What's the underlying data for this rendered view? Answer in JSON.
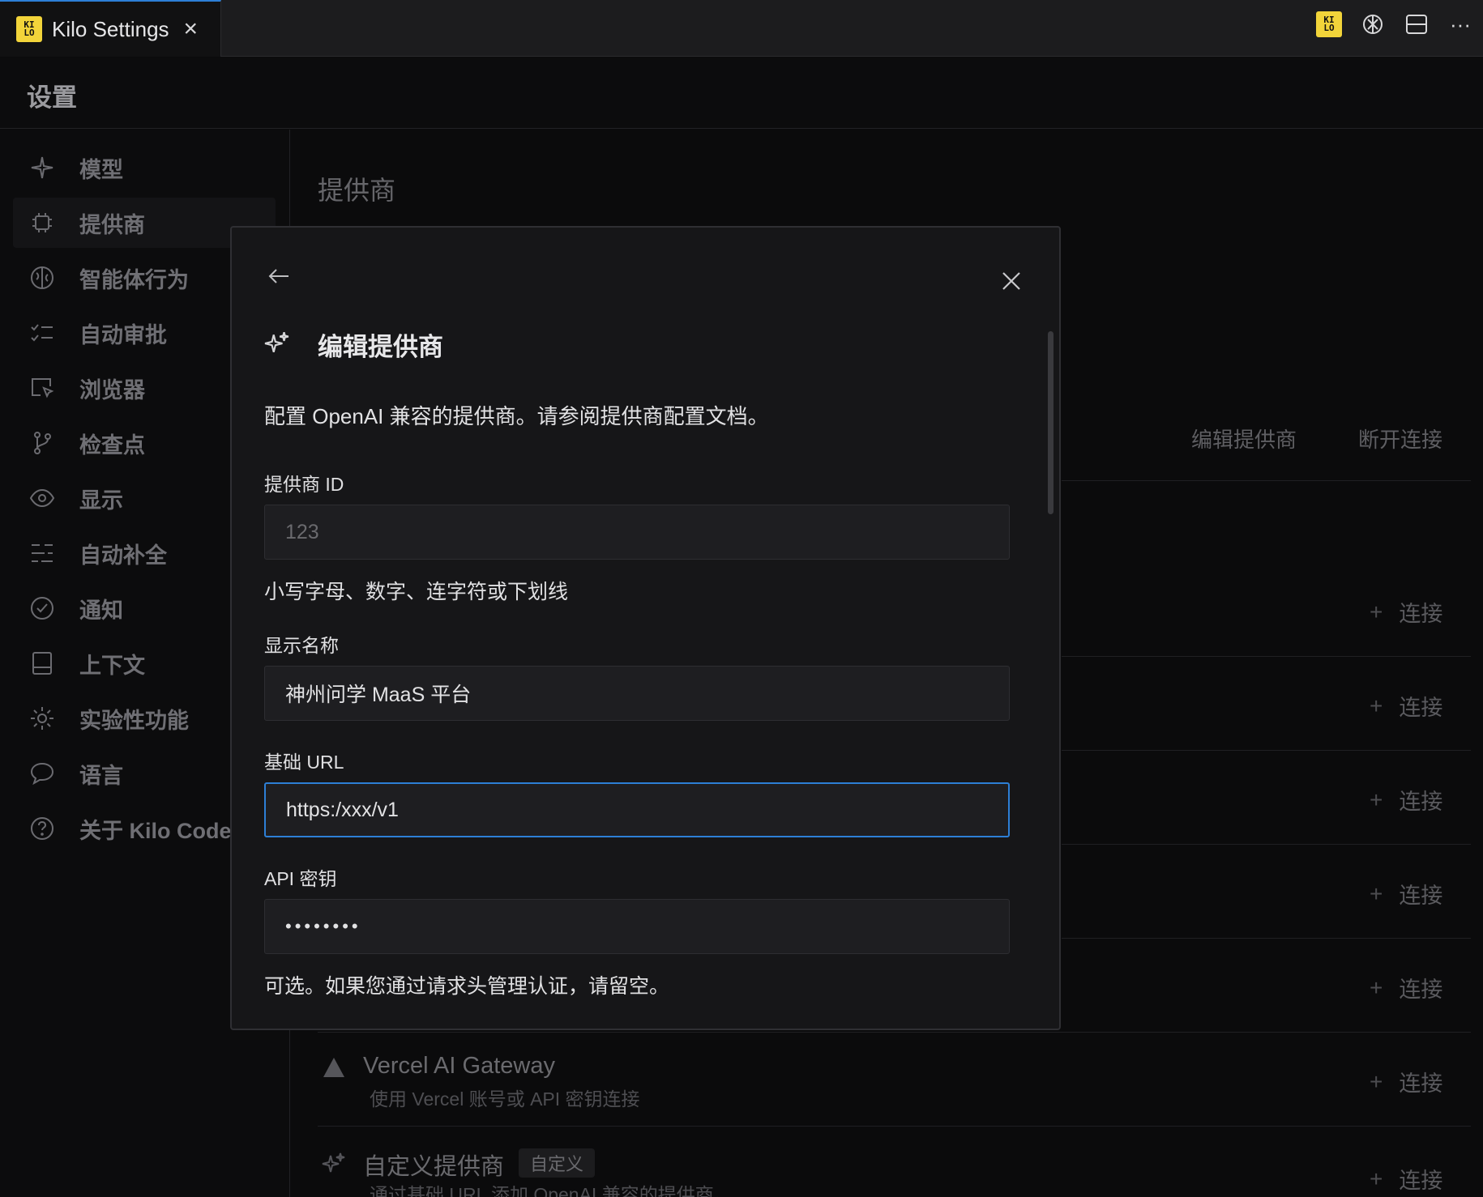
{
  "tab": {
    "title": "Kilo Settings",
    "logo_text": "KI LO"
  },
  "toolbar_right": [
    "kilo-logo-icon",
    "openai-icon",
    "layout-icon",
    "more-icon"
  ],
  "settings": {
    "title": "设置"
  },
  "sidebar": {
    "items": [
      {
        "label": "模型",
        "icon": "sparkle-icon"
      },
      {
        "label": "提供商",
        "icon": "chip-icon",
        "active": true
      },
      {
        "label": "智能体行为",
        "icon": "brain-icon"
      },
      {
        "label": "自动审批",
        "icon": "checklist-icon"
      },
      {
        "label": "浏览器",
        "icon": "browser-cursor-icon"
      },
      {
        "label": "检查点",
        "icon": "git-branch-icon"
      },
      {
        "label": "显示",
        "icon": "eye-icon"
      },
      {
        "label": "自动补全",
        "icon": "autocomplete-icon"
      },
      {
        "label": "通知",
        "icon": "check-circle-icon"
      },
      {
        "label": "上下文",
        "icon": "panel-icon"
      },
      {
        "label": "实验性功能",
        "icon": "gear-icon"
      },
      {
        "label": "语言",
        "icon": "chat-bubble-icon"
      },
      {
        "label": "关于 Kilo Code",
        "icon": "help-circle-icon"
      }
    ]
  },
  "main": {
    "title": "提供商",
    "edit_provider": "编辑提供商",
    "disconnect": "断开连接",
    "connect_label": "连接",
    "connect_plus": "+",
    "vercel": {
      "name": "Vercel AI Gateway",
      "desc": "使用 Vercel 账号或 API 密钥连接"
    },
    "custom": {
      "name": "自定义提供商",
      "badge": "自定义",
      "desc": "通过基础 URL 添加 OpenAI 兼容的提供商。"
    }
  },
  "modal": {
    "title": "编辑提供商",
    "description": "配置 OpenAI 兼容的提供商。请参阅提供商配置文档。",
    "provider_id": {
      "label": "提供商 ID",
      "placeholder": "123",
      "help": "小写字母、数字、连字符或下划线"
    },
    "display_name": {
      "label": "显示名称",
      "value": "神州问学 MaaS 平台"
    },
    "base_url": {
      "label": "基础 URL",
      "value": "https:/xxx/v1"
    },
    "api_key": {
      "label": "API 密钥",
      "value": "••••••••",
      "help": "可选。如果您通过请求头管理认证，请留空。"
    }
  }
}
